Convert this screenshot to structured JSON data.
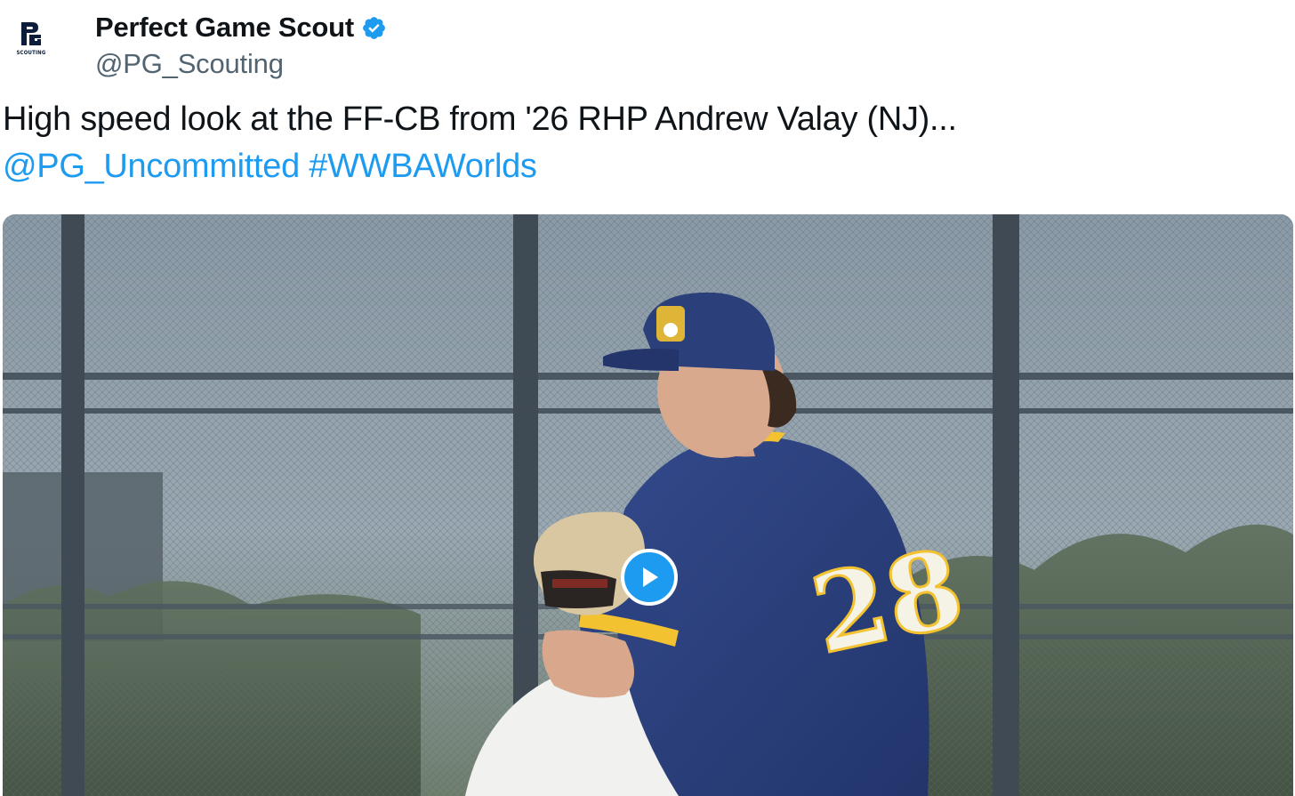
{
  "author": {
    "display_name": "Perfect Game Scout",
    "handle": "@PG_Scouting",
    "verified": true,
    "avatar_caption": "SCOUTING"
  },
  "tweet": {
    "text_main": "High speed look at the FF-CB from '26 RHP Andrew Valay (NJ)...",
    "mention": "@PG_Uncommitted",
    "hashtag": "#WWBAWorlds"
  },
  "media": {
    "type": "video",
    "jersey_number": "28",
    "controls": {
      "play_icon": "play-icon"
    }
  },
  "colors": {
    "link": "#1d9bf0",
    "verified": "#1d9bf0",
    "secondary_text": "#536471",
    "primary_text": "#0f1419",
    "jersey_navy": "#2b3f7a",
    "jersey_gold": "#f2c230"
  }
}
